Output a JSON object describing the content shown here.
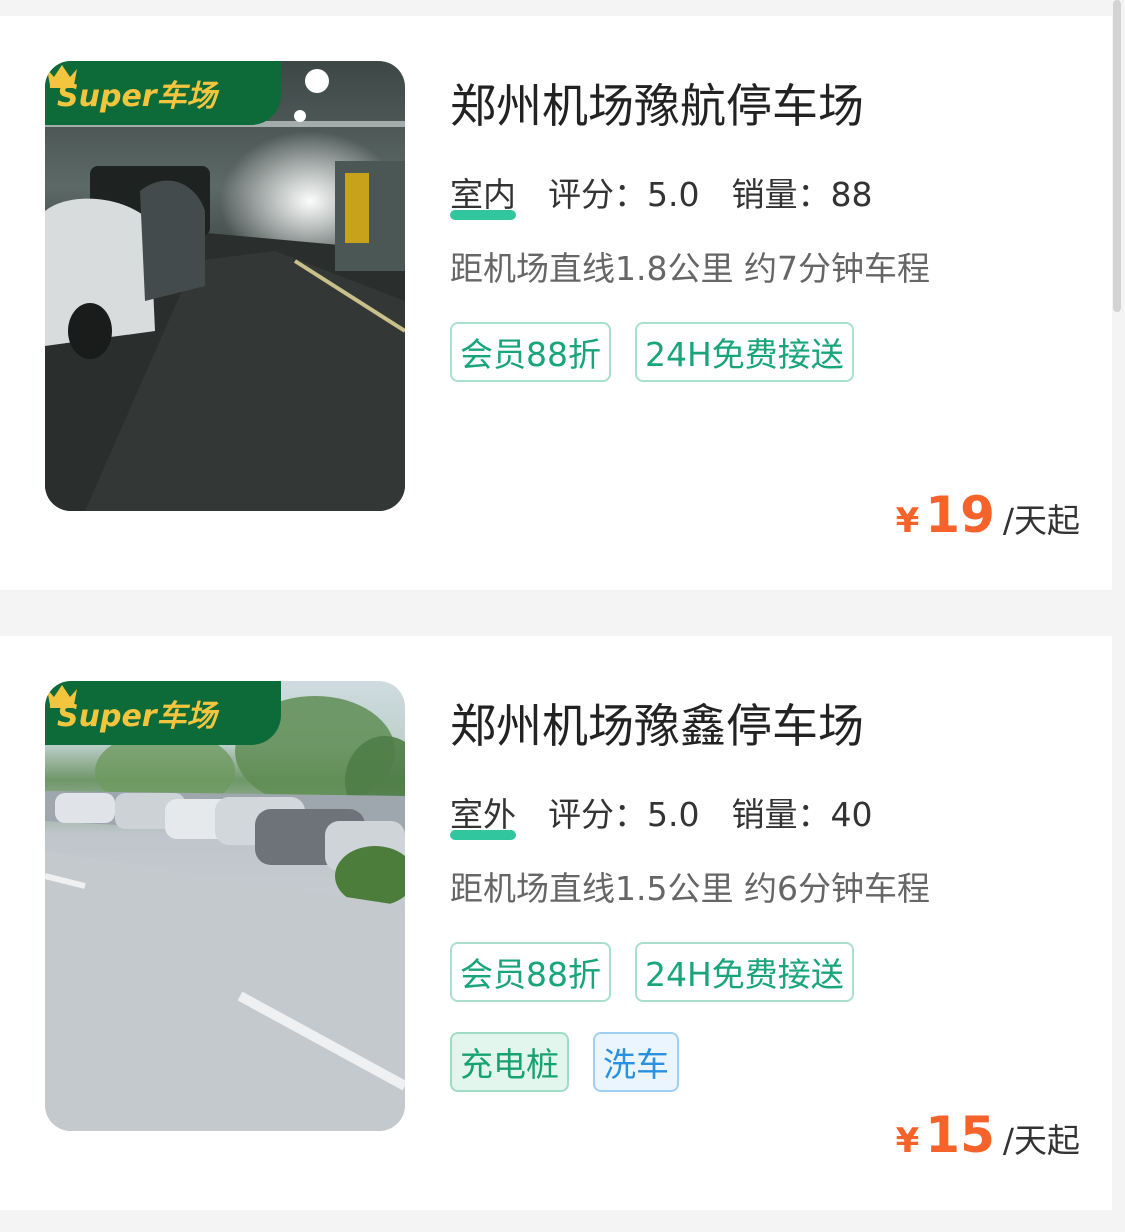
{
  "lots": [
    {
      "badge_text": "Super车场",
      "name": "郑州机场豫航停车场",
      "kind": "室内",
      "score": "评分：5.0",
      "sales": "销量：88",
      "distance": "距机场直线1.8公里 约7分钟车程",
      "tags": [
        "会员88折",
        "24H免费接送"
      ],
      "price_symbol": "¥",
      "price": "19",
      "price_unit": "/天起"
    },
    {
      "badge_text": "Super车场",
      "name": "郑州机场豫鑫停车场",
      "kind": "室外",
      "score": "评分：5.0",
      "sales": "销量：40",
      "distance": "距机场直线1.5公里 约6分钟车程",
      "tags": [
        "会员88折",
        "24H免费接送"
      ],
      "extra_tags": [
        "充电桩",
        "洗车"
      ],
      "price_symbol": "¥",
      "price": "15",
      "price_unit": "/天起"
    }
  ],
  "colors": {
    "badge_bg": "#0d6b3a",
    "badge_text": "#f3c53f",
    "price": "#f5622a",
    "tag_green": "#18a57a",
    "tag_blue": "#2b91de"
  },
  "icons": {
    "badge": "crown-icon"
  }
}
